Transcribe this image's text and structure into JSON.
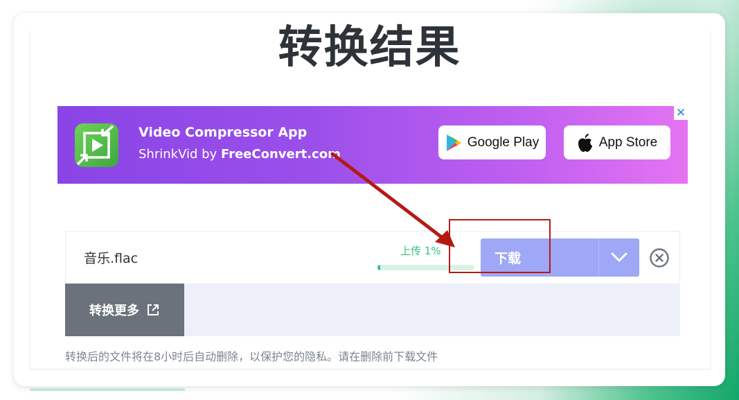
{
  "page": {
    "title": "转换结果"
  },
  "ad": {
    "app_title": "Video Compressor App",
    "subtitle_prefix": "ShrinkVid by ",
    "subtitle_brand": "FreeConvert.com",
    "google_play_label": "Google Play",
    "app_store_label": "App Store",
    "close_glyph": "✕",
    "icon": "video-compress-icon"
  },
  "file": {
    "name": "音乐.flac",
    "upload_status": "上传 1%",
    "progress": 0.01,
    "download_label": "下载",
    "dropdown_icon": "chevron-down-icon",
    "remove_icon": "close-circle-icon"
  },
  "actions": {
    "convert_more_label": "转换更多",
    "convert_more_icon": "external-link-icon"
  },
  "note": "转换后的文件将在8小时后自动删除，以保护您的隐私。请在删除前下载文件",
  "colors": {
    "accent_green": "#35c27e",
    "download_button": "#9ea8f6",
    "annotation_red": "#b41a14",
    "ad_gradient_start": "#8a44e6",
    "ad_gradient_end": "#e574f2"
  }
}
